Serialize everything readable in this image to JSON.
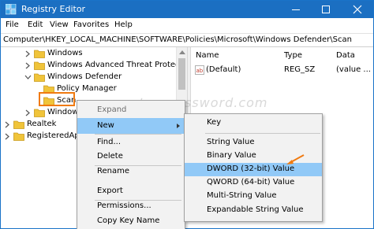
{
  "window": {
    "title": "Registry Editor",
    "controls": {
      "minimize": "minimize",
      "maximize": "maximize",
      "close": "close"
    }
  },
  "menubar": [
    "File",
    "Edit",
    "View",
    "Favorites",
    "Help"
  ],
  "address": "Computer\\HKEY_LOCAL_MACHINE\\SOFTWARE\\Policies\\Microsoft\\Windows Defender\\Scan",
  "tree": {
    "nodes": [
      {
        "label": "Windows",
        "expander": "collapsed"
      },
      {
        "label": "Windows Advanced Threat Protection",
        "expander": "collapsed"
      },
      {
        "label": "Windows Defender",
        "expander": "expanded"
      },
      {
        "label": "Policy Manager",
        "expander": "none"
      },
      {
        "label": "Scan",
        "expander": "none",
        "selected": true
      },
      {
        "label": "Windows",
        "expander": "collapsed"
      },
      {
        "label": "Realtek",
        "expander": "collapsed"
      },
      {
        "label": "RegisteredApp",
        "expander": "collapsed"
      }
    ]
  },
  "values": {
    "columns": [
      "Name",
      "Type",
      "Data"
    ],
    "rows": [
      {
        "name": "(Default)",
        "type": "REG_SZ",
        "data": "(value ..."
      }
    ]
  },
  "watermark": "top-password.com",
  "context_menu": {
    "items": [
      {
        "label": "Expand",
        "disabled": true
      },
      {
        "label": "New",
        "highlighted": true,
        "submenu": true
      },
      {
        "label": "Find..."
      },
      {
        "label": "Delete"
      },
      {
        "label": "Rename"
      },
      {
        "label": "Export"
      },
      {
        "label": "Permissions..."
      },
      {
        "label": "Copy Key Name"
      }
    ]
  },
  "submenu": {
    "items": [
      {
        "label": "Key"
      },
      {
        "label": "String Value"
      },
      {
        "label": "Binary Value"
      },
      {
        "label": "DWORD (32-bit) Value",
        "highlighted": true
      },
      {
        "label": "QWORD (64-bit) Value"
      },
      {
        "label": "Multi-String Value"
      },
      {
        "label": "Expandable String Value"
      }
    ]
  },
  "colors": {
    "titlebar": "#1b6fc2",
    "highlight": "#91c9f7",
    "folder": "#f0c43a",
    "annotation": "#f07a10"
  }
}
